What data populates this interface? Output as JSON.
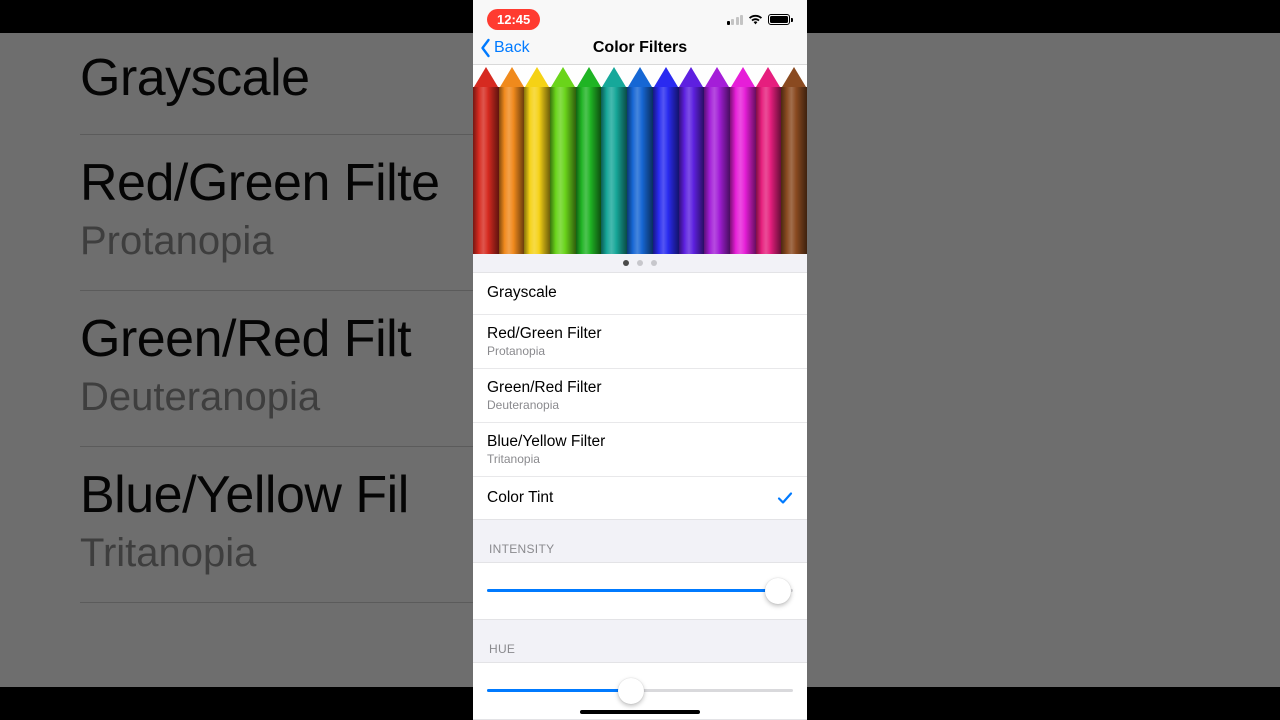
{
  "status": {
    "time": "12:45",
    "signal_bars_on": 1,
    "battery_level": 95
  },
  "nav": {
    "back_label": "Back",
    "title": "Color Filters"
  },
  "preview": {
    "pencil_colors": [
      "#d62a20",
      "#f08a1c",
      "#f5d215",
      "#6ad41a",
      "#1fb424",
      "#16a89a",
      "#1667d4",
      "#2a2af0",
      "#5e20e0",
      "#a41ed8",
      "#e61ed8",
      "#e61e7e",
      "#8a4a20"
    ],
    "page_index": 0,
    "page_count": 3
  },
  "options": [
    {
      "label": "Grayscale",
      "sub": "",
      "selected": false
    },
    {
      "label": "Red/Green Filter",
      "sub": "Protanopia",
      "selected": false
    },
    {
      "label": "Green/Red Filter",
      "sub": "Deuteranopia",
      "selected": false
    },
    {
      "label": "Blue/Yellow Filter",
      "sub": "Tritanopia",
      "selected": false
    },
    {
      "label": "Color Tint",
      "sub": "",
      "selected": true
    }
  ],
  "sliders": {
    "intensity": {
      "header": "Intensity",
      "value": 0.95
    },
    "hue": {
      "header": "Hue",
      "value": 0.47
    }
  },
  "bg_rows": [
    {
      "title": "Grayscale",
      "sub": ""
    },
    {
      "title": "Red/Green Filte",
      "sub": "Protanopia"
    },
    {
      "title": "Green/Red Filt",
      "sub": "Deuteranopia"
    },
    {
      "title": "Blue/Yellow Fil",
      "sub": "Tritanopia"
    }
  ]
}
